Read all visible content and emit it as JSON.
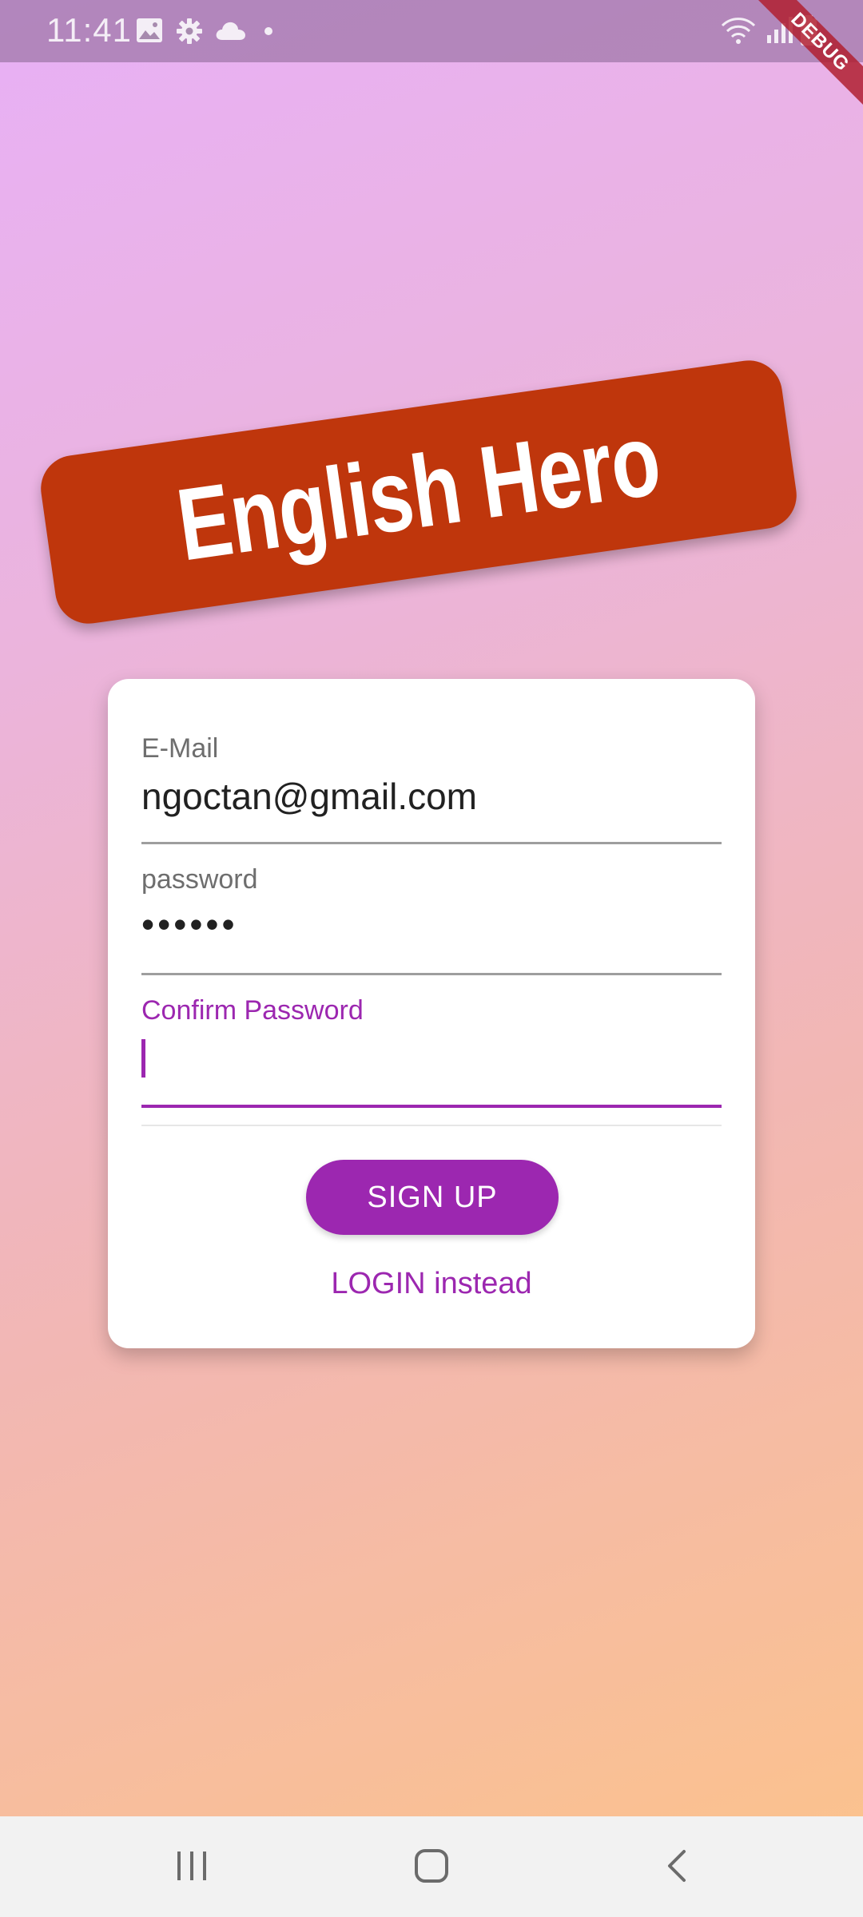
{
  "status_bar": {
    "time": "11:41",
    "icons": [
      "image-icon",
      "gear-icon",
      "cloud-icon",
      "dot-icon",
      "wifi-icon",
      "signal-icon",
      "battery-icon"
    ]
  },
  "debug_ribbon": {
    "label": "DEBUG"
  },
  "banner": {
    "title": "English Hero"
  },
  "form": {
    "email": {
      "label": "E-Mail",
      "value": "ngoctan@gmail.com"
    },
    "password": {
      "label": "password",
      "value": "••••••"
    },
    "confirm_password": {
      "label": "Confirm Password",
      "value": ""
    },
    "signup_label": "SIGN UP",
    "login_label": "LOGIN instead"
  },
  "colors": {
    "primary": "#9c27b0",
    "banner": "#bf360c",
    "gradient_start": "#e8b0f6",
    "gradient_end": "#fcc38a"
  },
  "nav_bar": {
    "icons": [
      "recents-icon",
      "home-icon",
      "back-icon"
    ]
  }
}
